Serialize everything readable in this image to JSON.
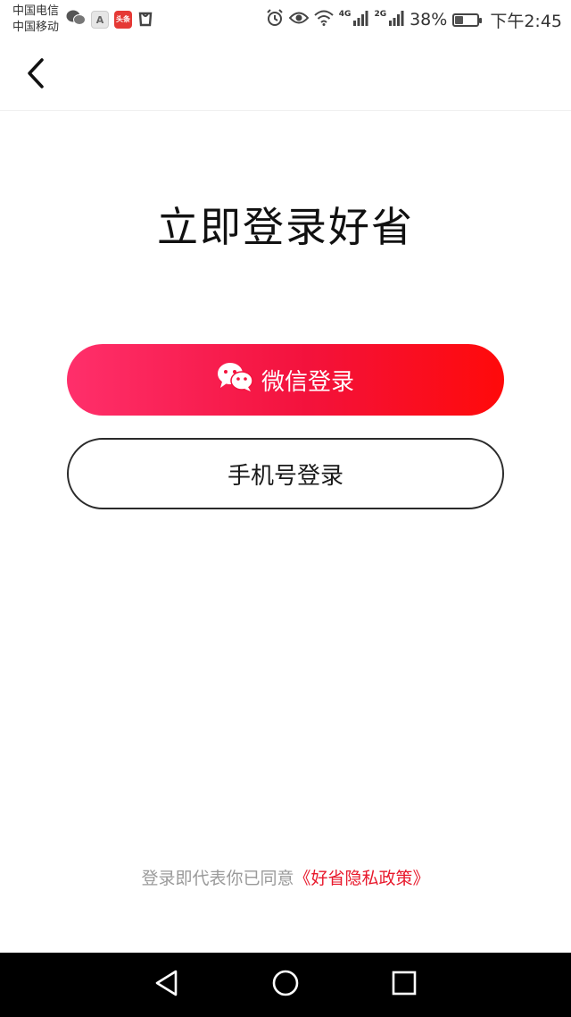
{
  "status_bar": {
    "carrier_1": "中国电信",
    "carrier_2": "中国移动",
    "app_icons": [
      "wechat-icon",
      "a-app-icon",
      "news-app-icon",
      "bag-icon"
    ],
    "a_icon_text": "A",
    "news_icon_text": "头条",
    "network_1": "4G",
    "network_2": "2G",
    "battery_percent": "38%",
    "battery_level": 0.38,
    "time": "下午2:45"
  },
  "header": {
    "back_icon": "chevron-left-icon"
  },
  "main": {
    "title": "立即登录好省",
    "wechat_login_label": "微信登录",
    "wechat_icon": "wechat-icon",
    "phone_login_label": "手机号登录"
  },
  "agreement": {
    "text": "登录即代表你已同意",
    "policy_link": "《好省隐私政策》"
  },
  "navbar": {
    "icons": [
      "back-triangle-icon",
      "home-circle-icon",
      "recents-square-icon"
    ]
  },
  "colors": {
    "accent_red": "#f3123c",
    "gradient_start": "#ff2f6b",
    "gradient_end": "#ff0a0a",
    "link_red": "#e8192c"
  }
}
